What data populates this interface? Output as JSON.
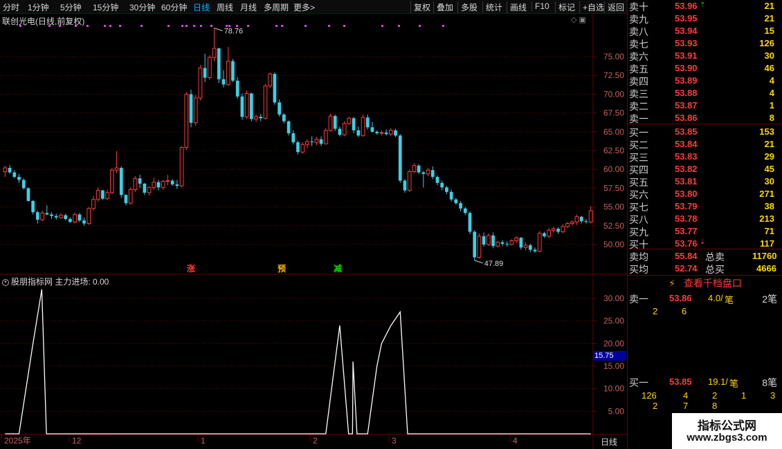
{
  "toolbar": {
    "periods": [
      "分时",
      "1分钟",
      "5分钟",
      "15分钟",
      "30分钟",
      "60分钟",
      "日线",
      "周线",
      "月线",
      "多周期",
      "更多>"
    ],
    "active_period": "日线",
    "actions": [
      "复权",
      "叠加",
      "多股",
      "统计",
      "画线",
      "F10",
      "标记",
      "+自选",
      "返回"
    ]
  },
  "chart": {
    "title": "联创光电(日线,前复权)",
    "high_label": "78.76",
    "low_label": "47.89",
    "price_ticks": [
      "75.00",
      "72.50",
      "70.00",
      "67.50",
      "65.00",
      "62.50",
      "60.00",
      "57.50",
      "55.00",
      "52.50",
      "50.00"
    ],
    "markers": [
      {
        "text": "涨",
        "color": "#ff3c3c"
      },
      {
        "text": "预",
        "color": "#ffb400"
      },
      {
        "text": "减",
        "color": "#00e000"
      }
    ],
    "date_labels": [
      "2025年",
      "12",
      "1",
      "2",
      "3",
      "4"
    ],
    "period_label": "日线"
  },
  "indicator": {
    "title": "股朋指标网 主力进场: 0.00",
    "ticks": [
      "30.00",
      "25.00",
      "20.00",
      "15.00",
      "10.00",
      "5.00"
    ],
    "current_tag": "15.75"
  },
  "quote": {
    "sell": [
      {
        "label": "卖十",
        "price": "53.96",
        "vol": "21"
      },
      {
        "label": "卖九",
        "price": "53.95",
        "vol": "21"
      },
      {
        "label": "卖八",
        "price": "53.94",
        "vol": "15"
      },
      {
        "label": "卖七",
        "price": "53.93",
        "vol": "126"
      },
      {
        "label": "卖六",
        "price": "53.91",
        "vol": "30"
      },
      {
        "label": "卖五",
        "price": "53.90",
        "vol": "46"
      },
      {
        "label": "卖四",
        "price": "53.89",
        "vol": "4"
      },
      {
        "label": "卖三",
        "price": "53.88",
        "vol": "4"
      },
      {
        "label": "卖二",
        "price": "53.87",
        "vol": "1"
      },
      {
        "label": "卖一",
        "price": "53.86",
        "vol": "8"
      }
    ],
    "buy": [
      {
        "label": "买一",
        "price": "53.85",
        "vol": "153"
      },
      {
        "label": "买二",
        "price": "53.84",
        "vol": "21"
      },
      {
        "label": "买三",
        "price": "53.83",
        "vol": "29"
      },
      {
        "label": "买四",
        "price": "53.82",
        "vol": "45"
      },
      {
        "label": "买五",
        "price": "53.81",
        "vol": "30"
      },
      {
        "label": "买六",
        "price": "53.80",
        "vol": "271"
      },
      {
        "label": "买七",
        "price": "53.79",
        "vol": "38"
      },
      {
        "label": "买八",
        "price": "53.78",
        "vol": "213"
      },
      {
        "label": "买九",
        "price": "53.77",
        "vol": "71"
      },
      {
        "label": "买十",
        "price": "53.76",
        "vol": "117"
      }
    ],
    "sell_avg_label": "卖均",
    "sell_avg": "55.84",
    "total_sell_label": "总卖",
    "total_sell": "11760",
    "buy_avg_label": "买均",
    "buy_avg": "52.74",
    "total_buy_label": "总买",
    "total_buy": "4666"
  },
  "orders": {
    "button": "查看千档盘口",
    "sell1": {
      "label": "卖一",
      "price": "53.86",
      "amount": "4.0/",
      "unit": "笔",
      "count": "2笔",
      "queue": [
        "2",
        "6"
      ]
    },
    "buy1": {
      "label": "买一",
      "price": "53.85",
      "amount": "19.1/",
      "unit": "笔",
      "count": "8笔",
      "queue": [
        "126",
        "4",
        "2",
        "1",
        "3",
        "2",
        "7",
        "8"
      ]
    }
  },
  "watermark": {
    "title": "指标公式网",
    "url": "www.zbgs3.com"
  },
  "colors": {
    "up": "#ff3c3c",
    "down": "#3ccfe6",
    "grid": "#6a0000",
    "line": "#ffffff"
  },
  "chart_data": {
    "type": "candlestick",
    "candles": [
      [
        59.7,
        60.5,
        59.0,
        60.2
      ],
      [
        60.2,
        60.6,
        59.4,
        59.6
      ],
      [
        59.6,
        59.9,
        58.8,
        59.0
      ],
      [
        59.0,
        59.4,
        58.2,
        58.6
      ],
      [
        58.6,
        58.8,
        57.3,
        57.5
      ],
      [
        57.5,
        57.6,
        55.7,
        55.8
      ],
      [
        55.8,
        55.9,
        54.0,
        54.3
      ],
      [
        54.3,
        54.5,
        52.8,
        53.3
      ],
      [
        53.3,
        54.5,
        53.1,
        54.2
      ],
      [
        54.2,
        55.2,
        53.9,
        54.0
      ],
      [
        54.0,
        54.3,
        53.4,
        53.8
      ],
      [
        53.8,
        54.1,
        53.3,
        53.6
      ],
      [
        53.6,
        54.2,
        53.4,
        53.9
      ],
      [
        53.9,
        54.1,
        53.2,
        53.4
      ],
      [
        53.4,
        53.6,
        52.9,
        53.0
      ],
      [
        53.0,
        54.3,
        52.8,
        54.0
      ],
      [
        54.0,
        54.2,
        53.0,
        53.2
      ],
      [
        53.2,
        53.6,
        52.5,
        52.8
      ],
      [
        52.8,
        55.0,
        52.6,
        54.8
      ],
      [
        54.8,
        56.5,
        54.5,
        56.0
      ],
      [
        56.0,
        57.6,
        55.7,
        57.2
      ],
      [
        57.2,
        57.3,
        55.9,
        56.1
      ],
      [
        56.1,
        57.3,
        55.9,
        56.9
      ],
      [
        56.9,
        60.2,
        56.7,
        59.9
      ],
      [
        59.9,
        62.4,
        59.5,
        60.2
      ],
      [
        60.2,
        60.4,
        56.2,
        56.6
      ],
      [
        56.6,
        56.7,
        55.2,
        55.5
      ],
      [
        55.5,
        57.6,
        55.3,
        57.3
      ],
      [
        57.3,
        59.1,
        57.0,
        58.8
      ],
      [
        58.8,
        59.3,
        57.5,
        58.1
      ],
      [
        58.1,
        58.2,
        56.6,
        56.9
      ],
      [
        56.9,
        57.7,
        56.5,
        57.6
      ],
      [
        57.6,
        58.9,
        57.3,
        58.3
      ],
      [
        58.3,
        58.6,
        57.2,
        57.6
      ],
      [
        57.6,
        58.6,
        57.3,
        58.4
      ],
      [
        58.4,
        59.3,
        57.9,
        58.5
      ],
      [
        58.5,
        58.7,
        57.8,
        58.0
      ],
      [
        58.0,
        58.6,
        57.4,
        57.8
      ],
      [
        57.8,
        63.1,
        57.6,
        62.9
      ],
      [
        62.9,
        70.3,
        62.6,
        70.0
      ],
      [
        70.0,
        70.6,
        65.6,
        66.2
      ],
      [
        66.2,
        69.9,
        65.8,
        69.5
      ],
      [
        69.5,
        73.9,
        69.2,
        73.5
      ],
      [
        73.5,
        75.4,
        71.6,
        72.2
      ],
      [
        72.2,
        75.2,
        71.9,
        74.9
      ],
      [
        74.9,
        78.8,
        74.4,
        76.1
      ],
      [
        76.1,
        76.2,
        71.5,
        72.0
      ],
      [
        72.0,
        73.2,
        70.9,
        71.3
      ],
      [
        71.3,
        76.3,
        71.1,
        74.4
      ],
      [
        74.4,
        74.7,
        71.6,
        71.8
      ],
      [
        71.8,
        72.3,
        69.4,
        69.7
      ],
      [
        69.7,
        70.1,
        66.6,
        67.0
      ],
      [
        67.0,
        70.5,
        66.7,
        70.1
      ],
      [
        70.1,
        70.2,
        66.4,
        66.7
      ],
      [
        66.7,
        67.3,
        66.3,
        67.0
      ],
      [
        67.0,
        67.4,
        66.4,
        66.8
      ],
      [
        66.8,
        71.4,
        66.6,
        71.1
      ],
      [
        71.1,
        72.9,
        70.8,
        72.7
      ],
      [
        72.7,
        72.9,
        68.6,
        68.9
      ],
      [
        68.9,
        69.3,
        67.0,
        67.3
      ],
      [
        67.3,
        67.5,
        66.1,
        66.4
      ],
      [
        66.4,
        66.5,
        64.5,
        64.8
      ],
      [
        64.8,
        65.2,
        63.3,
        63.6
      ],
      [
        63.6,
        63.8,
        62.0,
        62.3
      ],
      [
        62.3,
        63.6,
        62.1,
        63.3
      ],
      [
        63.3,
        64.0,
        62.8,
        63.7
      ],
      [
        63.7,
        64.4,
        63.1,
        63.6
      ],
      [
        63.6,
        64.3,
        63.2,
        64.0
      ],
      [
        64.0,
        64.4,
        63.1,
        63.4
      ],
      [
        63.4,
        65.5,
        63.3,
        65.2
      ],
      [
        65.2,
        67.4,
        65.0,
        67.1
      ],
      [
        67.1,
        67.3,
        65.1,
        65.4
      ],
      [
        65.4,
        65.7,
        64.4,
        64.6
      ],
      [
        64.6,
        66.4,
        64.4,
        66.1
      ],
      [
        66.1,
        67.0,
        65.9,
        66.8
      ],
      [
        66.8,
        67.0,
        64.8,
        65.2
      ],
      [
        65.2,
        65.7,
        64.3,
        64.5
      ],
      [
        64.5,
        67.3,
        64.3,
        66.9
      ],
      [
        66.9,
        67.3,
        65.3,
        65.6
      ],
      [
        65.6,
        66.3,
        64.9,
        65.0
      ],
      [
        65.0,
        65.2,
        64.6,
        64.8
      ],
      [
        64.8,
        65.2,
        64.5,
        64.9
      ],
      [
        64.9,
        65.3,
        64.5,
        64.7
      ],
      [
        64.7,
        65.5,
        64.4,
        65.2
      ],
      [
        65.2,
        65.4,
        64.3,
        64.5
      ],
      [
        64.5,
        64.7,
        58.2,
        58.5
      ],
      [
        58.5,
        58.7,
        56.9,
        57.2
      ],
      [
        57.2,
        60.0,
        57.0,
        59.7
      ],
      [
        59.7,
        60.8,
        59.5,
        60.5
      ],
      [
        60.5,
        60.7,
        59.4,
        59.6
      ],
      [
        59.6,
        59.8,
        57.6,
        59.4
      ],
      [
        59.4,
        60.2,
        59.1,
        59.9
      ],
      [
        59.9,
        60.4,
        58.7,
        59.0
      ],
      [
        59.0,
        59.2,
        57.9,
        58.2
      ],
      [
        58.2,
        58.5,
        57.2,
        57.6
      ],
      [
        57.6,
        57.8,
        56.7,
        57.0
      ],
      [
        57.0,
        57.3,
        55.7,
        56.0
      ],
      [
        56.0,
        56.2,
        55.3,
        55.5
      ],
      [
        55.5,
        55.8,
        54.4,
        54.8
      ],
      [
        54.8,
        55.0,
        53.9,
        54.2
      ],
      [
        54.2,
        54.4,
        51.4,
        51.7
      ],
      [
        51.7,
        51.9,
        47.9,
        48.3
      ],
      [
        48.3,
        51.5,
        48.1,
        51.1
      ],
      [
        51.1,
        51.6,
        49.7,
        50.0
      ],
      [
        50.0,
        51.5,
        49.8,
        51.2
      ],
      [
        51.2,
        51.6,
        49.5,
        49.8
      ],
      [
        49.8,
        50.5,
        49.6,
        50.3
      ],
      [
        50.3,
        50.6,
        49.8,
        50.1
      ],
      [
        50.1,
        50.4,
        49.7,
        50.0
      ],
      [
        50.0,
        50.7,
        49.9,
        50.5
      ],
      [
        50.5,
        51.1,
        50.2,
        50.9
      ],
      [
        50.9,
        51.0,
        49.3,
        49.6
      ],
      [
        49.6,
        50.3,
        49.2,
        49.9
      ],
      [
        49.9,
        50.1,
        49.0,
        49.3
      ],
      [
        49.3,
        49.6,
        48.9,
        49.1
      ],
      [
        49.1,
        51.8,
        49.0,
        51.5
      ],
      [
        51.5,
        51.7,
        50.9,
        51.1
      ],
      [
        51.1,
        52.2,
        50.8,
        51.9
      ],
      [
        51.9,
        52.4,
        51.6,
        52.1
      ],
      [
        52.1,
        52.3,
        51.4,
        51.7
      ],
      [
        51.7,
        52.7,
        51.5,
        52.4
      ],
      [
        52.4,
        53.0,
        52.2,
        52.8
      ],
      [
        52.8,
        53.2,
        52.5,
        53.0
      ],
      [
        53.0,
        54.0,
        52.6,
        53.7
      ],
      [
        53.7,
        53.8,
        52.8,
        53.1
      ],
      [
        53.1,
        53.4,
        52.8,
        53.0
      ],
      [
        53.0,
        55.1,
        52.8,
        54.5
      ]
    ],
    "indicator_name": "主力进场",
    "indicator_values": [
      0,
      0,
      0,
      0,
      0,
      0,
      0,
      0,
      0,
      0,
      0,
      0,
      0,
      0,
      0,
      0,
      0,
      0,
      0,
      0,
      0,
      0,
      0,
      0,
      0,
      0,
      0,
      0,
      0,
      0,
      0,
      0,
      0,
      0,
      0,
      0,
      0,
      0,
      0,
      0,
      0,
      0,
      0,
      0,
      0,
      0,
      0,
      0,
      0,
      0,
      0,
      0,
      0,
      0,
      0,
      0,
      0,
      0,
      0,
      0,
      0,
      0,
      0,
      0,
      0,
      0,
      0,
      0,
      0,
      0,
      0,
      0,
      0,
      0,
      0,
      0,
      0,
      0,
      0,
      0,
      0,
      0,
      0,
      0,
      0,
      0,
      0,
      0,
      0,
      0,
      0,
      0,
      0,
      0,
      0,
      0,
      0,
      0,
      0,
      0,
      0,
      0,
      0,
      0,
      0,
      0,
      0,
      0,
      0,
      0,
      0,
      0,
      0,
      0,
      0,
      0,
      0,
      0,
      0,
      0,
      0,
      0,
      0,
      0,
      0,
      0,
      0,
      0,
      0,
      0,
      0,
      0,
      0,
      0,
      0,
      0,
      0,
      0,
      0,
      0,
      0,
      0,
      0,
      0,
      0,
      0,
      0,
      0,
      0,
      0,
      0,
      0,
      0,
      0,
      0,
      0,
      0,
      0,
      0,
      0,
      0,
      0,
      0,
      0,
      0,
      0,
      0,
      0,
      0,
      0,
      0,
      0,
      0,
      0,
      0,
      0,
      0,
      0,
      0,
      0,
      0,
      0,
      0,
      0,
      0,
      0,
      0,
      0,
      0,
      0,
      0,
      0,
      0,
      0,
      0,
      0,
      0,
      0,
      0,
      0,
      0,
      0,
      0,
      0,
      0,
      0,
      0,
      0,
      0,
      0,
      0,
      0,
      0,
      0,
      0,
      0,
      0,
      0,
      0,
      0,
      0,
      0,
      0,
      0,
      0,
      0,
      0,
      0,
      0,
      0,
      0,
      0,
      0,
      0,
      0,
      0,
      0,
      0,
      0,
      0,
      0,
      0,
      0,
      0,
      0,
      0,
      0,
      0,
      0,
      0,
      0,
      0,
      0,
      0,
      0,
      0,
      0,
      0,
      0,
      0,
      0,
      0,
      0,
      0,
      0,
      0,
      0,
      0,
      0,
      0,
      0,
      0,
      0,
      0,
      0,
      0,
      0,
      0,
      0,
      0,
      0,
      0,
      0,
      0,
      0,
      0,
      0,
      0,
      0,
      0,
      0,
      0,
      0,
      0,
      0,
      0,
      0,
      0,
      0,
      0,
      0,
      0,
      0,
      0,
      0,
      0,
      0,
      0,
      0,
      0,
      0,
      0,
      0,
      0,
      0,
      0,
      0,
      0,
      0,
      0
    ],
    "indicator_peaks": [
      {
        "from_day": 0,
        "to_day": 4,
        "peak_day": 7,
        "end_day": 8,
        "peak": 32
      },
      {
        "from_day": 69,
        "peak_day": 72,
        "end_day": 75,
        "peak": 24
      },
      {
        "from_day": 74,
        "peak_day": 75,
        "end_day": 76,
        "peak": 16
      },
      {
        "from_day": 79,
        "peak_day": 85,
        "end_day": 86,
        "peak": 27
      }
    ],
    "ylim": [
      47,
      80
    ],
    "indicator_ylim": [
      0,
      35
    ]
  }
}
